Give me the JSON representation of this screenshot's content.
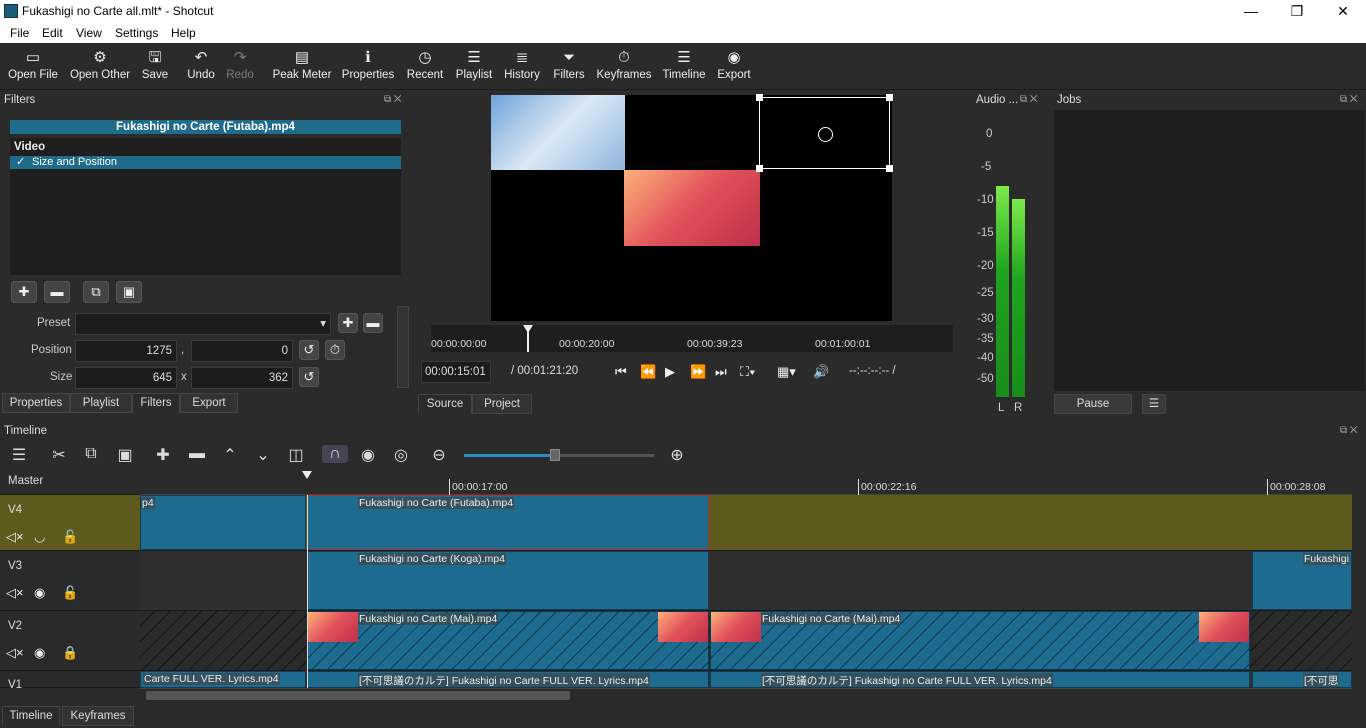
{
  "window": {
    "title": "Fukashigi no Carte all.mlt* - Shotcut",
    "minimize": "—",
    "restore": "❐",
    "close": "✕"
  },
  "menu": [
    "File",
    "Edit",
    "View",
    "Settings",
    "Help"
  ],
  "toolbar": [
    {
      "label": "Open File",
      "icon": "open-file-icon",
      "glyph": "▭"
    },
    {
      "label": "Open Other",
      "icon": "open-other-icon",
      "glyph": "⚙"
    },
    {
      "label": "Save",
      "icon": "save-icon",
      "glyph": "🖫"
    },
    {
      "label": "Undo",
      "icon": "undo-icon",
      "glyph": "↶"
    },
    {
      "label": "Redo",
      "icon": "redo-icon",
      "glyph": "↷"
    },
    {
      "label": "Peak Meter",
      "icon": "peak-meter-icon",
      "glyph": "▤"
    },
    {
      "label": "Properties",
      "icon": "info-icon",
      "glyph": "ℹ"
    },
    {
      "label": "Recent",
      "icon": "clock-icon",
      "glyph": "◷"
    },
    {
      "label": "Playlist",
      "icon": "list-icon",
      "glyph": "☰"
    },
    {
      "label": "History",
      "icon": "history-icon",
      "glyph": "≣"
    },
    {
      "label": "Filters",
      "icon": "filter-icon",
      "glyph": "⏷"
    },
    {
      "label": "Keyframes",
      "icon": "stopwatch-icon",
      "glyph": "⏱"
    },
    {
      "label": "Timeline",
      "icon": "timeline-icon",
      "glyph": "☰"
    },
    {
      "label": "Export",
      "icon": "export-icon",
      "glyph": "◉"
    }
  ],
  "filters": {
    "title": "Filters",
    "clip_name": "Fukashigi no Carte (Futaba).mp4",
    "section": "Video",
    "items": [
      {
        "label": "Size and Position",
        "checked": "✓"
      }
    ],
    "preset_label": "Preset",
    "position_label": "Position",
    "position_x": "1275",
    "position_sep": ",",
    "position_y": "0",
    "size_label": "Size",
    "size_w": "645",
    "size_sep": "x",
    "size_h": "362"
  },
  "left_tabs": [
    "Properties",
    "Playlist",
    "Filters",
    "Export"
  ],
  "player": {
    "ruler_ticks": [
      "00:00:00:00",
      "00:00:20:00",
      "00:00:39:23",
      "00:01:00:01"
    ],
    "current_time": "00:00:15:01",
    "total_time": "/ 00:01:21:20",
    "inout": "--:--:--:-- /",
    "tabs": [
      "Source",
      "Project"
    ]
  },
  "audio": {
    "title": "Audio ...",
    "scale": [
      "0",
      "-5",
      "-10",
      "-15",
      "-20",
      "-25",
      "-30",
      "-35",
      "-40",
      "-50"
    ],
    "left": "L",
    "right": "R",
    "level_left": 0.72,
    "level_right": 0.68
  },
  "jobs": {
    "title": "Jobs",
    "pause": "Pause",
    "menu": "☰"
  },
  "timeline": {
    "title": "Timeline",
    "master": "Master",
    "ticks": [
      "00:00:17:00",
      "00:00:22:16",
      "00:00:28:08"
    ],
    "tracks": [
      {
        "name": "V4"
      },
      {
        "name": "V3"
      },
      {
        "name": "V2"
      },
      {
        "name": "V1"
      }
    ],
    "clips": {
      "v4_a": "p4",
      "v4_b": "Fukashigi no Carte (Futaba).mp4",
      "v3_a": "Fukashigi no Carte (Koga).mp4",
      "v3_b": "Fukashigi",
      "v2_a": "Fukashigi no Carte (Mai).mp4",
      "v2_b": "Fukashigi no Carte (Mai).mp4",
      "v1_a": "Carte FULL VER. Lyrics.mp4",
      "v1_b": "[不可思議のカルテ] Fukashigi no Carte FULL VER. Lyrics.mp4",
      "v1_c": "[不可思議のカルテ] Fukashigi no Carte FULL VER. Lyrics.mp4",
      "v1_d": "[不可思"
    }
  },
  "bottom_tabs": [
    "Timeline",
    "Keyframes"
  ]
}
